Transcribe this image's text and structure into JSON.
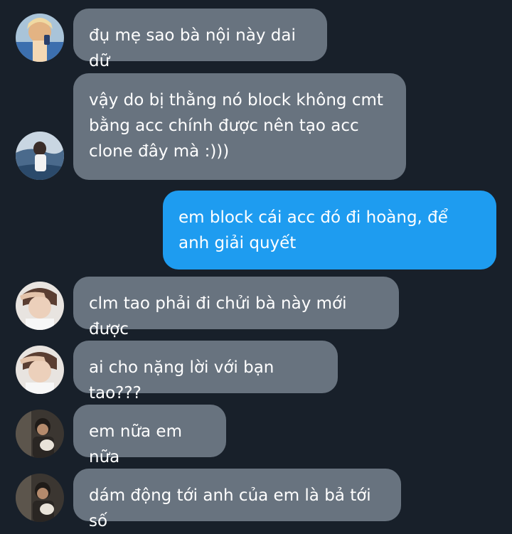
{
  "messages": [
    {
      "from": "other",
      "avatar": "avatar-blond",
      "text": "đụ mẹ sao bà nội này dai dữ"
    },
    {
      "from": "other",
      "avatar": "avatar-sea",
      "text": "vậy do bị thằng nó block không cmt bằng acc chính được nên tạo acc clone đây mà :)))"
    },
    {
      "from": "me",
      "text": "em block cái acc đó đi hoàng, để anh giải quyết"
    },
    {
      "from": "other",
      "avatar": "avatar-salute",
      "text": "clm tao phải đi chửi bà này mới được"
    },
    {
      "from": "other",
      "avatar": "avatar-salute",
      "text": "ai cho nặng lời với bạn tao???"
    },
    {
      "from": "other",
      "avatar": "avatar-dark",
      "text": "em nữa em nữa"
    },
    {
      "from": "other",
      "avatar": "avatar-dark",
      "text": "dám động tới anh của em là bả tới số"
    }
  ],
  "colors": {
    "background": "#18202a",
    "incoming_bubble": "#68737f",
    "outgoing_bubble": "#1e9cf0",
    "text": "#ffffff"
  }
}
